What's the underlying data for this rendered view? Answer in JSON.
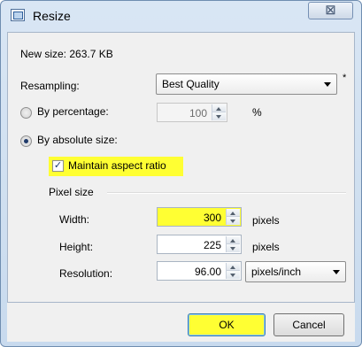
{
  "window": {
    "title": "Resize",
    "close_glyph": "☒"
  },
  "new_size": "New size: 263.7 KB",
  "resampling": {
    "label": "Resampling:",
    "value": "Best Quality",
    "asterisk": "*"
  },
  "by_percentage": {
    "label": "By percentage:",
    "value": "100",
    "unit": "%",
    "selected": false
  },
  "by_absolute": {
    "label": "By absolute size:",
    "selected": true
  },
  "maintain_aspect": {
    "label": "Maintain aspect ratio",
    "checked": true,
    "check_glyph": "✓"
  },
  "pixel_size": {
    "heading": "Pixel size",
    "width": {
      "label": "Width:",
      "value": "300",
      "unit": "pixels"
    },
    "height": {
      "label": "Height:",
      "value": "225",
      "unit": "pixels"
    },
    "resolution": {
      "label": "Resolution:",
      "value": "96.00",
      "unit": "pixels/inch"
    }
  },
  "buttons": {
    "ok": "OK",
    "cancel": "Cancel"
  },
  "colors": {
    "highlight": "#ffff33",
    "title_bg": "#cfdff0"
  }
}
